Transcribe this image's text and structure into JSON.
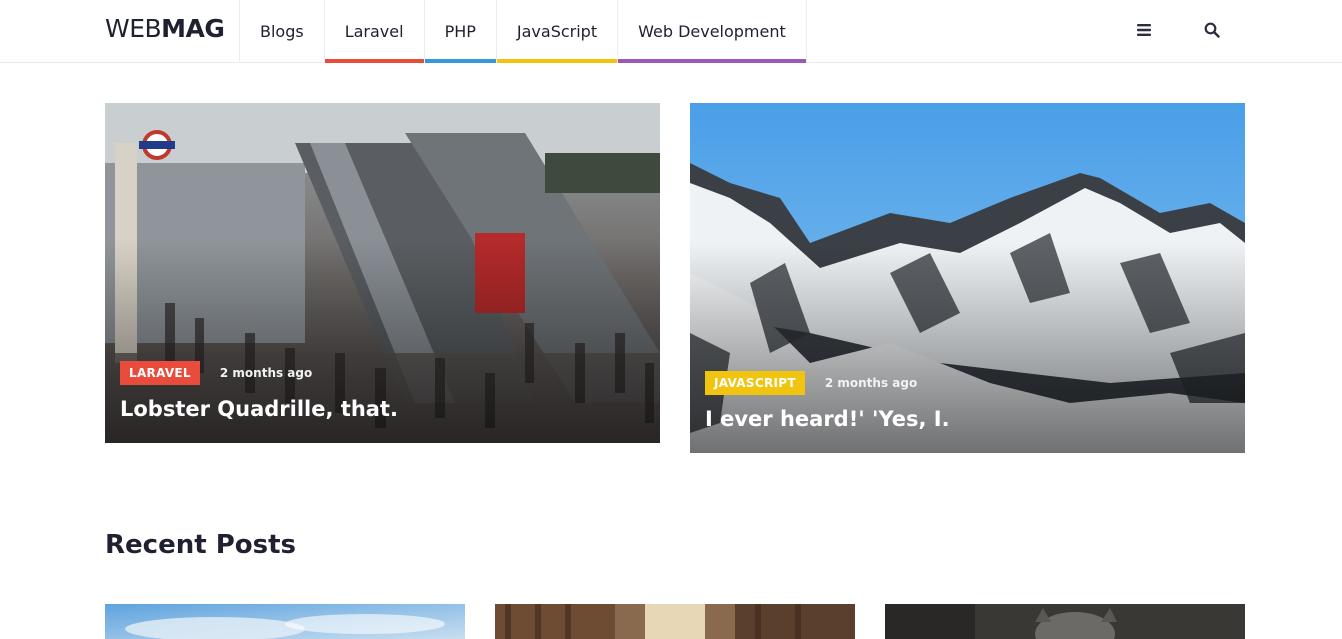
{
  "header": {
    "logo_light": "WEB",
    "logo_bold": "MAG",
    "nav": [
      {
        "label": "Blogs",
        "accent": ""
      },
      {
        "label": "Laravel",
        "accent": "#e74c3c"
      },
      {
        "label": "PHP",
        "accent": "#3498db"
      },
      {
        "label": "JavaScript",
        "accent": "#f1c40f"
      },
      {
        "label": "Web Development",
        "accent": "#9b59b6"
      }
    ],
    "icons": [
      "menu-icon",
      "search-icon"
    ]
  },
  "featured": [
    {
      "category": "LARAVEL",
      "category_color": "#e74c3c",
      "time": "2 months ago",
      "title": "Lobster Quadrille, that."
    },
    {
      "category": "JAVASCRIPT",
      "category_color": "#f1c40f",
      "time": "2 months ago",
      "title": "I ever heard!' 'Yes, I."
    }
  ],
  "recent": {
    "heading": "Recent Posts"
  }
}
